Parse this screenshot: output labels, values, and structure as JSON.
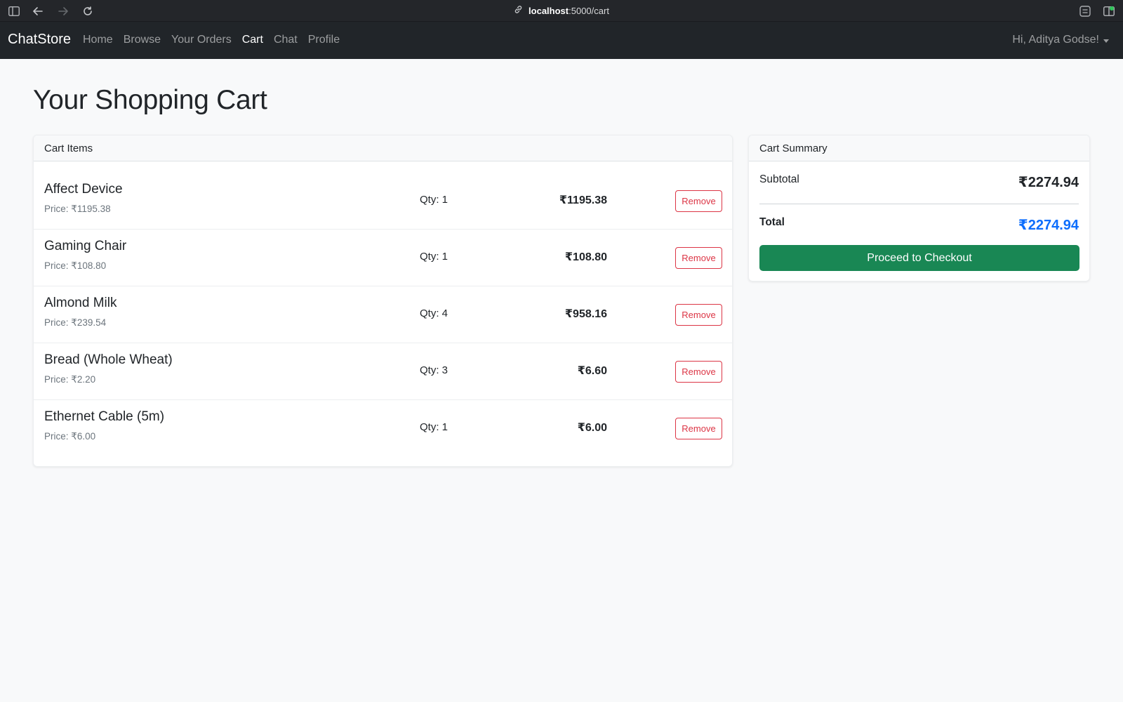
{
  "browser": {
    "url_host": "localhost",
    "url_path": ":5000/cart"
  },
  "navbar": {
    "brand": "ChatStore",
    "links": [
      {
        "label": "Home",
        "active": false
      },
      {
        "label": "Browse",
        "active": false
      },
      {
        "label": "Your Orders",
        "active": false
      },
      {
        "label": "Cart",
        "active": true
      },
      {
        "label": "Chat",
        "active": false
      },
      {
        "label": "Profile",
        "active": false
      }
    ],
    "user_greeting": "Hi, Aditya Godse!"
  },
  "page": {
    "title": "Your Shopping Cart"
  },
  "cart": {
    "header": "Cart Items",
    "remove_label": "Remove",
    "items": [
      {
        "name": "Affect Device",
        "price": "Price: ₹1195.38",
        "qty": "Qty: 1",
        "total": "₹1195.38"
      },
      {
        "name": "Gaming Chair",
        "price": "Price: ₹108.80",
        "qty": "Qty: 1",
        "total": "₹108.80"
      },
      {
        "name": "Almond Milk",
        "price": "Price: ₹239.54",
        "qty": "Qty: 4",
        "total": "₹958.16"
      },
      {
        "name": "Bread (Whole Wheat)",
        "price": "Price: ₹2.20",
        "qty": "Qty: 3",
        "total": "₹6.60"
      },
      {
        "name": "Ethernet Cable (5m)",
        "price": "Price: ₹6.00",
        "qty": "Qty: 1",
        "total": "₹6.00"
      }
    ]
  },
  "summary": {
    "header": "Cart Summary",
    "subtotal_label": "Subtotal",
    "subtotal_value": "₹2274.94",
    "total_label": "Total",
    "total_value": "₹2274.94",
    "checkout_label": "Proceed to Checkout"
  },
  "colors": {
    "navbar_bg": "#212529",
    "remove": "#dc3545",
    "total_accent": "#0d6efd",
    "checkout": "#198754"
  }
}
